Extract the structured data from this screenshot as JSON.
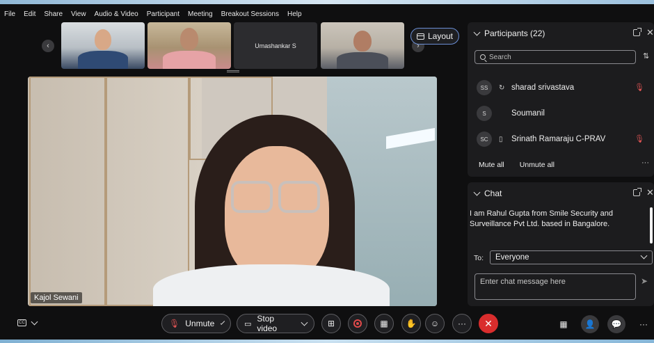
{
  "menu": [
    "File",
    "Edit",
    "Share",
    "View",
    "Audio & Video",
    "Participant",
    "Meeting",
    "Breakout Sessions",
    "Help"
  ],
  "thumbnails": {
    "third_name": "Umashankar S"
  },
  "layout_label": "Layout",
  "main_video": {
    "name": "Kajol Sewani"
  },
  "participants": {
    "title": "Participants (22)",
    "search_placeholder": "Search",
    "items": [
      {
        "initials": "SS",
        "name": "sharad srivastava",
        "status_icon": "sync-icon",
        "muted": true
      },
      {
        "initials": "S",
        "name": "Soumanil",
        "status_icon": "",
        "muted": false
      },
      {
        "initials": "SC",
        "name": "Srinath Ramaraju C-PRAV",
        "status_icon": "phone-icon",
        "muted": true
      }
    ],
    "mute_all": "Mute all",
    "unmute_all": "Unmute all"
  },
  "chat": {
    "title": "Chat",
    "message": "I am Rahul Gupta from Smile Security and Surveillance Pvt Ltd. based in Bangalore.",
    "to_label": "To:",
    "to_value": "Everyone",
    "input_placeholder": "Enter chat message here"
  },
  "toolbar": {
    "unmute": "Unmute",
    "stop_video": "Stop video"
  },
  "colors": {
    "end_call": "#d92d2d",
    "muted_icon": "#e05454",
    "layout_border": "#6b8fd6"
  }
}
